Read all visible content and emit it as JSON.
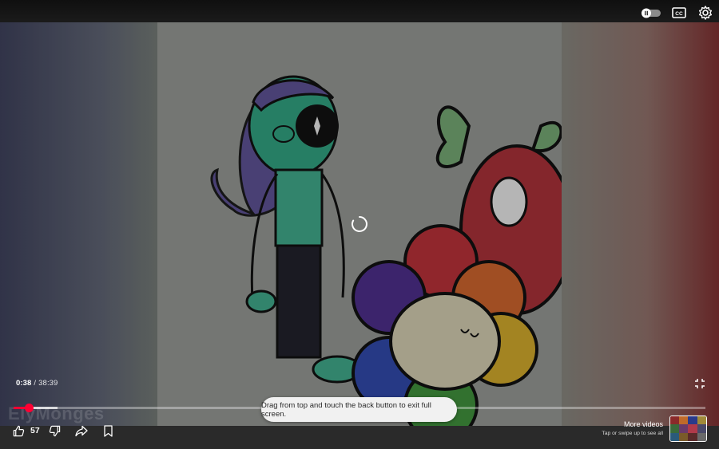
{
  "player": {
    "time_current": "0:38",
    "time_separator": "/",
    "time_duration": "38:39",
    "progress_fraction": 0.022,
    "buffered_fraction": 0.064,
    "loading": true
  },
  "top_controls": {
    "autoplay_icon": "autoplay-pause-toggle-icon",
    "cc_icon": "closed-captions-icon",
    "settings_icon": "gear-icon"
  },
  "watermark": "ElyMonges",
  "toast": "Drag from top and touch the back button to exit full screen.",
  "actions": {
    "like_count": "57",
    "like_icon": "thumbs-up-icon",
    "dislike_icon": "thumbs-down-icon",
    "share_icon": "share-arrow-icon",
    "save_icon": "bookmark-icon"
  },
  "more_videos": {
    "title": "More videos",
    "subtitle": "Tap or swipe up to see all"
  },
  "colors": {
    "progress_played": "#ff0033",
    "toast_bg": "#f1f1f1",
    "top_bar": "#0f0f0f",
    "bottom_bar": "#2a2a2a"
  }
}
